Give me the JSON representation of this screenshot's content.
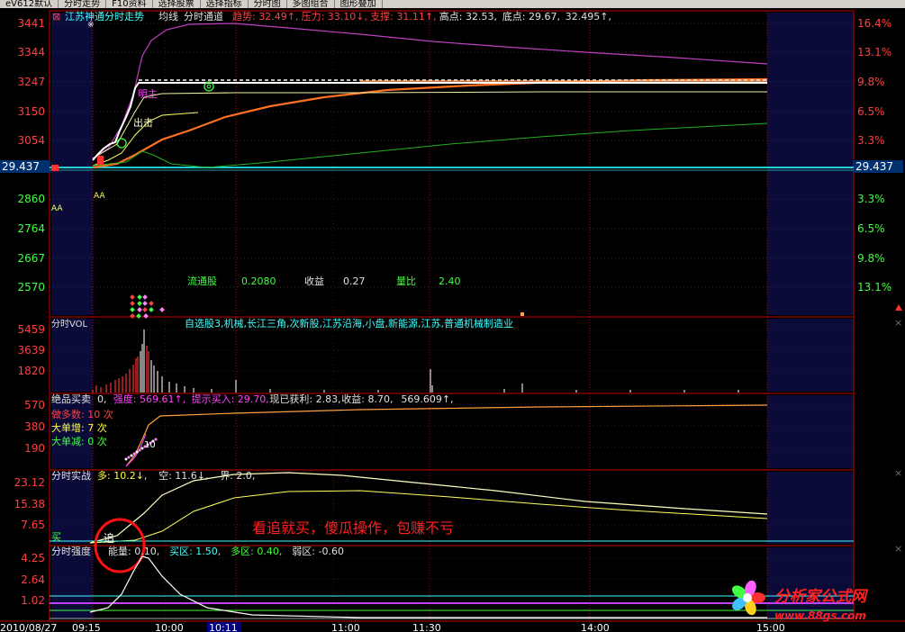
{
  "toolbar": {
    "items": [
      "eV612默认",
      "分时走势",
      "F10资料",
      "选择股票",
      "选择指标",
      "分时图",
      "多图组合",
      "图形叠加"
    ]
  },
  "main": {
    "stock_name": "江苏神通分时走势",
    "mode_labels": [
      "均线",
      "分时通道"
    ],
    "indicators": [
      {
        "label": "趋势",
        "value": "32.49",
        "arrow": "↑",
        "color": "#ff4040"
      },
      {
        "label": "压力",
        "value": "33.10",
        "arrow": "↓",
        "color": "#ff4040"
      },
      {
        "label": "支撑",
        "value": "31.11",
        "arrow": "↑",
        "color": "#ff4040"
      },
      {
        "label": "高点",
        "value": "32.53",
        "arrow": "",
        "color": "#e0e0e0"
      },
      {
        "label": "底点",
        "value": "29.67",
        "arrow": "",
        "color": "#e0e0e0"
      },
      {
        "label": "",
        "value": "32.495",
        "arrow": "↑",
        "color": "#e0e0e0"
      }
    ],
    "left_axis": [
      "3441",
      "3344",
      "3247",
      "3150",
      "3054",
      "2860",
      "2764",
      "2667",
      "2570"
    ],
    "right_axis": [
      "16.4%",
      "13.1%",
      "9.8%",
      "6.5%",
      "3.3%",
      "3.3%",
      "6.5%",
      "9.8%",
      "13.1%"
    ],
    "prev_close": "29.437",
    "annotations": {
      "mingzhu": "明主",
      "chuji": "出击",
      "aa1": "AA",
      "aa2": "AA"
    },
    "stats": {
      "float_label": "流通股",
      "float_value": "0.2080",
      "eps_label": "收益",
      "eps_value": "0.27",
      "vr_label": "量比",
      "vr_value": "2.40"
    }
  },
  "vol_panel": {
    "title": "分时VOL",
    "tags": "自选股3,机械,长江三角,次新股,江苏沿海,小盘,新能源,江苏,普通机械制造业",
    "axis": [
      "5459",
      "3639",
      "1820"
    ]
  },
  "jp_panel": {
    "title": "绝品买卖",
    "params": [
      {
        "text": "0,",
        "color": "#e0e0e0"
      },
      {
        "text": "强度: 569.61↑,",
        "color": "#ff40ff"
      },
      {
        "text": "提示买入: 29.70,",
        "color": "#ff40ff"
      },
      {
        "text": "现已获利: 2.83,",
        "color": "#e0e0e0"
      },
      {
        "text": "收益: 8.70,",
        "color": "#e0e0e0"
      },
      {
        "text": "569.609↑,",
        "color": "#e0e0e0"
      }
    ],
    "axis": [
      "570",
      "380",
      "190"
    ],
    "legend": [
      {
        "label": "做多数: 10 次",
        "color": "#ff4040"
      },
      {
        "label": "大单增: 7 次",
        "color": "#ffff40"
      },
      {
        "label": "大单减: 0 次",
        "color": "#40ff40"
      }
    ],
    "mark": "10"
  },
  "ss_panel": {
    "title": "分时实战",
    "params": [
      {
        "text": "多: 10.2↓,",
        "color": "#ffff40"
      },
      {
        "text": "空: 11.6↓,",
        "color": "#e0e0e0"
      },
      {
        "text": "界: 2.0,",
        "color": "#e0e0e0"
      }
    ],
    "axis": [
      "23.12",
      "15.38",
      "7.65"
    ],
    "buy_label": "买",
    "chase_label": "追",
    "caption": "看追就买，傻瓜操作，包赚不亏"
  },
  "qd_panel": {
    "title": "分时强度",
    "params": [
      {
        "text": "能量: 0.10,",
        "color": "#e0e0e0"
      },
      {
        "text": "买区: 1.50,",
        "color": "#40ffff"
      },
      {
        "text": "多区: 0.40,",
        "color": "#40ff40"
      },
      {
        "text": "弱区: -0.60",
        "color": "#e0e0e0"
      }
    ],
    "axis": [
      "4.25",
      "2.64",
      "1.02"
    ]
  },
  "time_axis": [
    "2010/08/27",
    "09:15",
    "10:00",
    "10:11",
    "11:00",
    "11:30",
    "14:00",
    "15:00"
  ],
  "watermark": {
    "brand": "分析家公式网",
    "url": "www.88gs.com"
  },
  "colors": {
    "grid": "#aa0000",
    "price": "#ffffff",
    "avg": "#ffff60",
    "upper": "#c040c0",
    "trend": "#ff6020",
    "mid": "#f0f0a0",
    "low": "#20b020",
    "prev": "#20e0e0"
  }
}
